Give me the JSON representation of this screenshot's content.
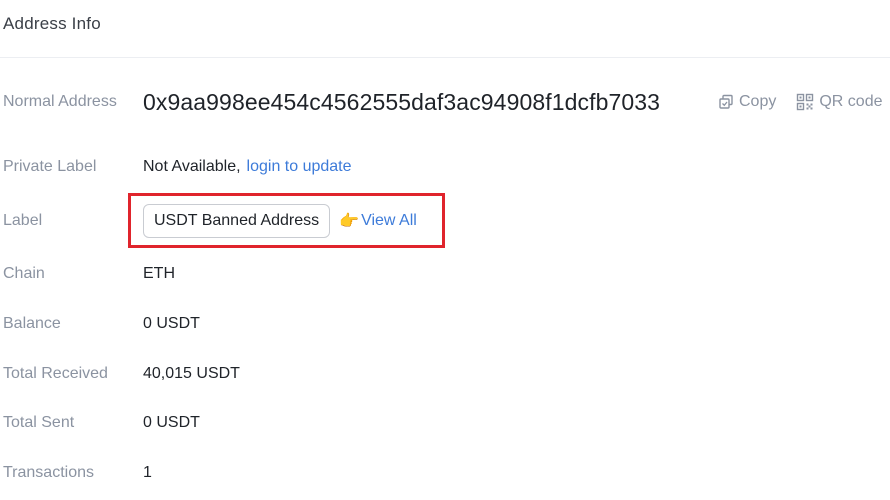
{
  "card": {
    "title": "Address Info"
  },
  "address": {
    "label": "Normal Address",
    "value": "0x9aa998ee454c4562555daf3ac94908f1dcfb7033",
    "copy_label": "Copy",
    "qr_label": "QR code"
  },
  "private_label": {
    "label": "Private Label",
    "text": "Not Available,",
    "link": "login to update"
  },
  "tag_row": {
    "label": "Label",
    "tag": "USDT Banned Address",
    "view_all": "View All",
    "hand_icon": "👉"
  },
  "chain": {
    "label": "Chain",
    "value": "ETH"
  },
  "balance": {
    "label": "Balance",
    "value": "0 USDT"
  },
  "total_received": {
    "label": "Total Received",
    "value": "40,015 USDT"
  },
  "total_sent": {
    "label": "Total Sent",
    "value": "0 USDT"
  },
  "transactions": {
    "label": "Transactions",
    "value": "1"
  },
  "colors": {
    "link": "#3d7bd9",
    "muted": "#8b93a1",
    "highlight": "#e0242c"
  }
}
